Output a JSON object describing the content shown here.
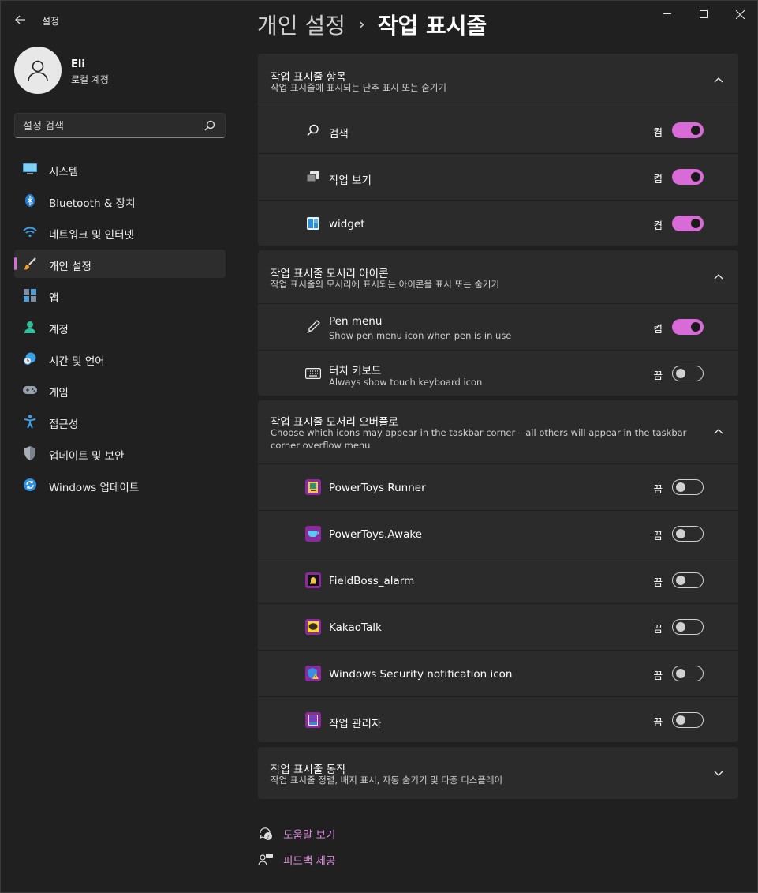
{
  "titlebar": {
    "app_title": "설정"
  },
  "profile": {
    "name": "Eli",
    "account_type": "로컬 계정"
  },
  "search": {
    "placeholder": "설정 검색"
  },
  "sidebar": {
    "items": [
      {
        "label": "시스템",
        "icon": "monitor-icon"
      },
      {
        "label": "Bluetooth & 장치",
        "icon": "bluetooth-icon"
      },
      {
        "label": "네트워크 및 인터넷",
        "icon": "wifi-icon"
      },
      {
        "label": "개인 설정",
        "icon": "brush-icon",
        "active": true
      },
      {
        "label": "앱",
        "icon": "apps-icon"
      },
      {
        "label": "계정",
        "icon": "person-icon"
      },
      {
        "label": "시간 및 언어",
        "icon": "clock-globe-icon"
      },
      {
        "label": "게임",
        "icon": "gamepad-icon"
      },
      {
        "label": "접근성",
        "icon": "accessibility-icon"
      },
      {
        "label": "업데이트 및 보안",
        "icon": "shield-icon"
      },
      {
        "label": "Windows 업데이트",
        "icon": "sync-icon"
      }
    ]
  },
  "breadcrumb": {
    "parent": "개인 설정",
    "separator": "›",
    "current": "작업 표시줄"
  },
  "sections": {
    "taskbar_items": {
      "title": "작업 표시줄 항목",
      "desc": "작업 표시줄에 표시되는 단추 표시 또는 숨기기",
      "rows": [
        {
          "label": "검색",
          "state": "켬"
        },
        {
          "label": "작업 보기",
          "state": "켬"
        },
        {
          "label": "widget",
          "state": "켬"
        }
      ]
    },
    "corner_icons": {
      "title": "작업 표시줄 모서리 아이콘",
      "desc": "작업 표시줄의 모서리에 표시되는 아이콘을 표시 또는 숨기기",
      "rows": [
        {
          "label": "Pen menu",
          "sub": "Show pen menu icon when pen is in use",
          "state": "켬"
        },
        {
          "label": "터치 키보드",
          "sub": "Always show touch keyboard icon",
          "state": "끔"
        }
      ]
    },
    "overflow": {
      "title": "작업 표시줄 모서리 오버플로",
      "desc": "Choose which icons may appear in the taskbar corner – all others will appear in the taskbar corner overflow menu",
      "rows": [
        {
          "label": "PowerToys Runner",
          "state": "끔"
        },
        {
          "label": "PowerToys.Awake",
          "state": "끔"
        },
        {
          "label": "FieldBoss_alarm",
          "state": "끔"
        },
        {
          "label": "KakaoTalk",
          "state": "끔"
        },
        {
          "label": "Windows Security notification icon",
          "state": "끔"
        },
        {
          "label": "작업 관리자",
          "state": "끔"
        }
      ]
    },
    "behaviors": {
      "title": "작업 표시줄 동작",
      "desc": "작업 표시줄 정렬, 배지 표시, 자동 숨기기 및 다중 디스플레이"
    }
  },
  "footer": {
    "help": "도움말 보기",
    "feedback": "피드백 제공"
  },
  "colors": {
    "accent": "#d86bd8",
    "card": "#2b2b2b",
    "window": "#202020"
  }
}
